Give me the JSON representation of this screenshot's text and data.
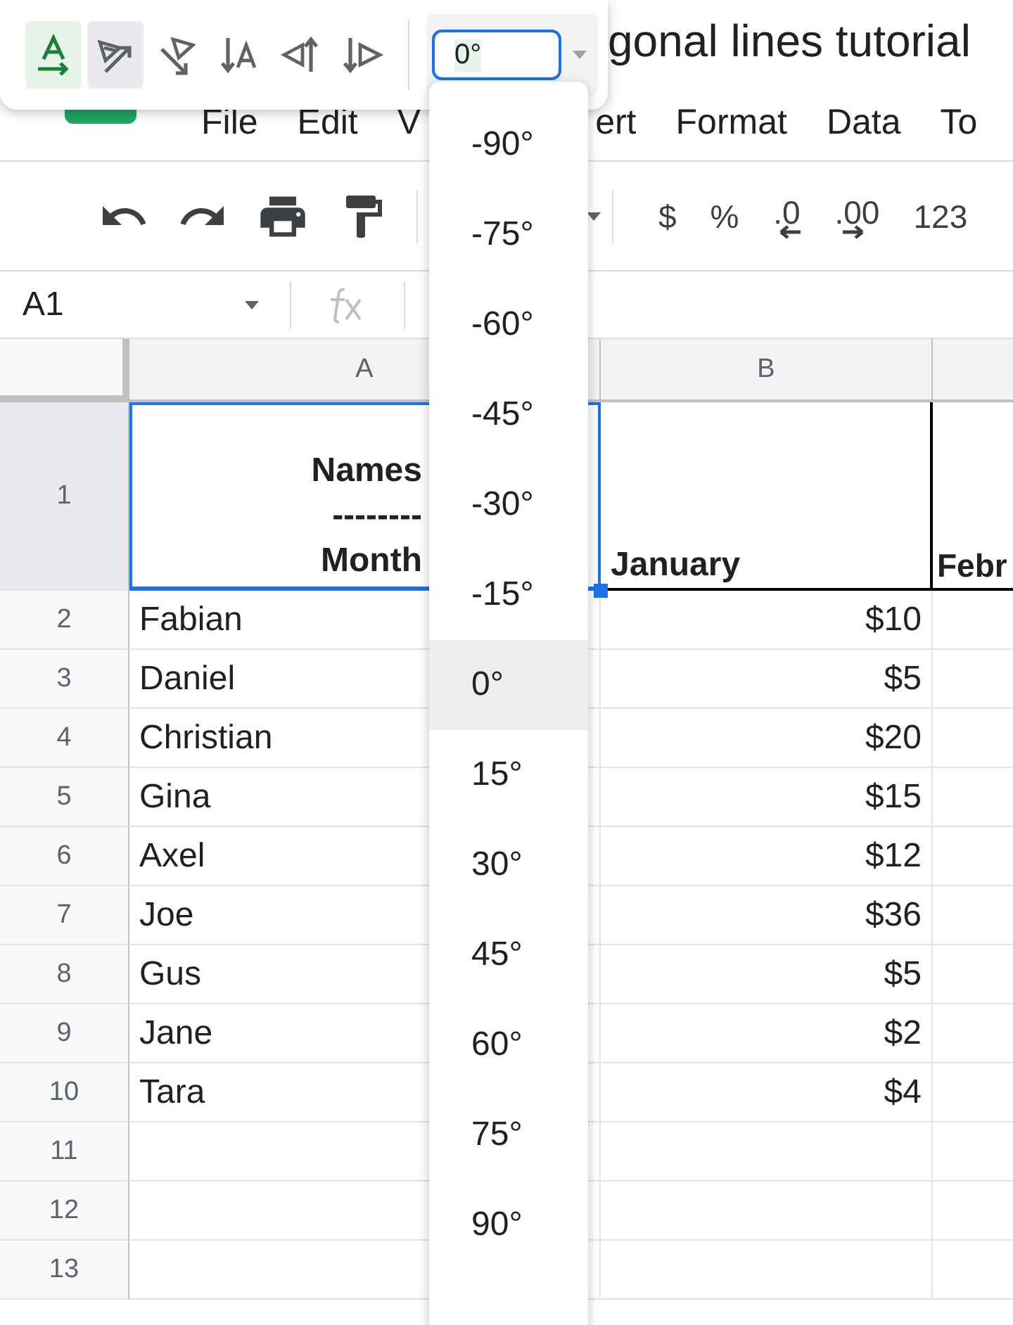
{
  "rotation_toolbar": {
    "options": [
      {
        "kind": "none",
        "selected": true,
        "highlighted": false
      },
      {
        "kind": "tilt-up",
        "selected": false,
        "highlighted": true
      },
      {
        "kind": "tilt-down",
        "selected": false,
        "highlighted": false
      },
      {
        "kind": "stack",
        "selected": false,
        "highlighted": false
      },
      {
        "kind": "rotate-up",
        "selected": false,
        "highlighted": false
      },
      {
        "kind": "rotate-down",
        "selected": false,
        "highlighted": false
      }
    ],
    "angle_field": {
      "value": "0°"
    }
  },
  "angle_menu": {
    "items": [
      {
        "label": "-90°",
        "selected": false
      },
      {
        "label": "-75°",
        "selected": false
      },
      {
        "label": "-60°",
        "selected": false
      },
      {
        "label": "-45°",
        "selected": false
      },
      {
        "label": "-30°",
        "selected": false
      },
      {
        "label": "-15°",
        "selected": false
      },
      {
        "label": "0°",
        "selected": true
      },
      {
        "label": "15°",
        "selected": false
      },
      {
        "label": "30°",
        "selected": false
      },
      {
        "label": "45°",
        "selected": false
      },
      {
        "label": "60°",
        "selected": false
      },
      {
        "label": "75°",
        "selected": false
      },
      {
        "label": "90°",
        "selected": false
      }
    ]
  },
  "document": {
    "title": "gonal lines tutorial"
  },
  "menu": {
    "left": [
      "File",
      "Edit",
      "V"
    ],
    "right": [
      "ert",
      "Format",
      "Data",
      "To"
    ]
  },
  "toolbar": {
    "format_buttons": [
      {
        "kind": "text",
        "label": "$"
      },
      {
        "kind": "text",
        "label": "%"
      },
      {
        "kind": "decrease",
        "label": ".0"
      },
      {
        "kind": "increase",
        "label": ".00"
      },
      {
        "kind": "text",
        "label": "123"
      }
    ]
  },
  "formula_bar": {
    "cell_ref": "A1"
  },
  "sheet": {
    "columns": [
      "A",
      "B"
    ],
    "header_row": {
      "number": "1",
      "a_lines": [
        "Names",
        "--------",
        "Month"
      ],
      "b": "January",
      "c": "Febr"
    },
    "rows": [
      {
        "number": "2",
        "name": "Fabian",
        "january": "$10"
      },
      {
        "number": "3",
        "name": "Daniel",
        "january": "$5"
      },
      {
        "number": "4",
        "name": "Christian",
        "january": "$20"
      },
      {
        "number": "5",
        "name": "Gina",
        "january": "$15"
      },
      {
        "number": "6",
        "name": "Axel",
        "january": "$12"
      },
      {
        "number": "7",
        "name": "Joe",
        "january": "$36"
      },
      {
        "number": "8",
        "name": "Gus",
        "january": "$5"
      },
      {
        "number": "9",
        "name": "Jane",
        "january": "$2"
      },
      {
        "number": "10",
        "name": "Tara",
        "january": "$4"
      },
      {
        "number": "11"
      },
      {
        "number": "12"
      },
      {
        "number": "13"
      }
    ]
  }
}
